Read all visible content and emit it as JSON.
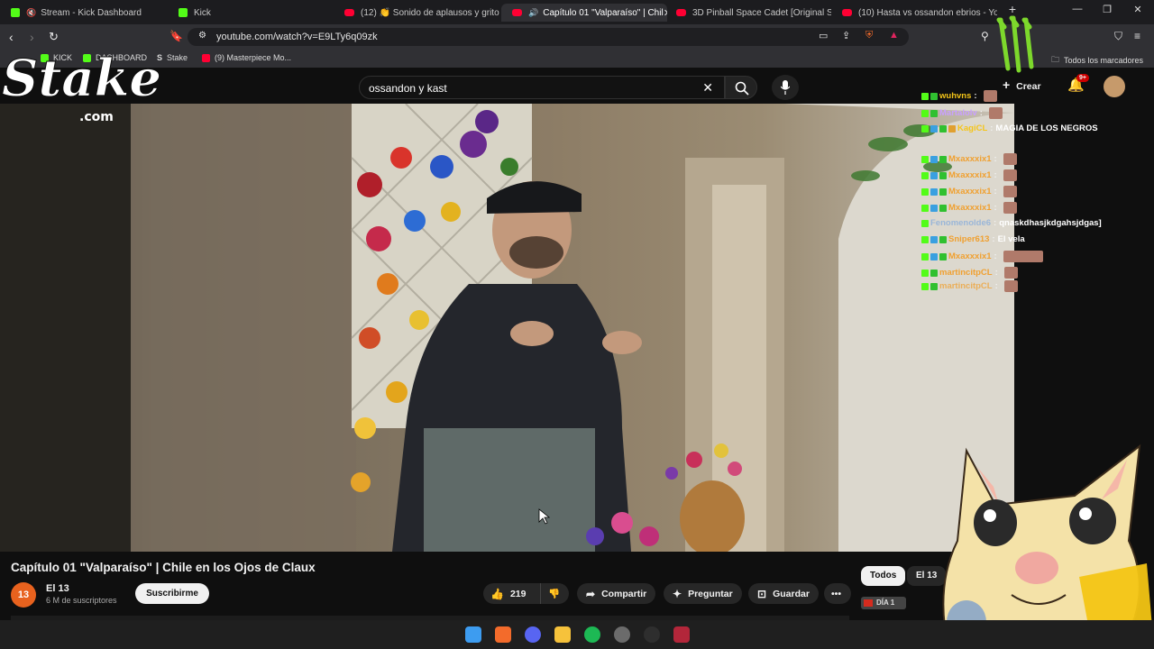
{
  "browser": {
    "tabs": [
      {
        "label": "Stream - Kick Dashboard",
        "favicon": "kick-icon"
      },
      {
        "label": "Kick",
        "favicon": "kick-icon"
      },
      {
        "label": "(12) 👏 Sonido de aplausos y gritos",
        "favicon": "youtube-icon"
      },
      {
        "label": "Capítulo 01 \"Valparaíso\" | Chil",
        "favicon": "youtube-icon",
        "active": true
      },
      {
        "label": "3D Pinball Space Cadet [Original Sou",
        "favicon": "youtube-icon"
      },
      {
        "label": "(10) Hasta vs ossandon ebrios - YouT",
        "favicon": "youtube-icon"
      }
    ],
    "url": "youtube.com/watch?v=E9LTy6q09zk",
    "bookmarks": [
      {
        "label": "KICK"
      },
      {
        "label": "DASHBOARD"
      },
      {
        "label": "Stake"
      },
      {
        "label": "(9) Masterpiece Mo..."
      }
    ],
    "all_bookmarks_label": "Todos los marcadores"
  },
  "youtube": {
    "search_value": "ossandon y kast",
    "create_label": "Crear",
    "notification_count": "9+",
    "video_title": "Capítulo 01 \"Valparaíso\" | Chile en los Ojos de Claux",
    "channel": {
      "avatar_text": "13",
      "name": "El 13",
      "subscribers": "6 M de suscriptores",
      "subscribe_label": "Suscribirme"
    },
    "actions": {
      "like_count": "219",
      "share_label": "Compartir",
      "ask_label": "Preguntar",
      "save_label": "Guardar"
    },
    "chips": [
      "Todos",
      "El 13"
    ]
  },
  "overlay": {
    "stake_logo_text": "Stake",
    "stake_logo_sub": ".com",
    "chat": [
      {
        "user": "wuhvns",
        "msg": "",
        "color": "#f5c518"
      },
      {
        "user": "Martalolv",
        "msg": "",
        "color": "#c9a0ff"
      },
      {
        "user": "KagiCL",
        "msg": "MAGIA DE LOS NEGROS",
        "color": "#f5c518"
      },
      {
        "user": "Mxaxxxix1",
        "msg": "",
        "color": "#f0a030"
      },
      {
        "user": "Mxaxxxix1",
        "msg": "",
        "color": "#f0a030"
      },
      {
        "user": "Mxaxxxix1",
        "msg": "",
        "color": "#f0a030"
      },
      {
        "user": "Mxaxxxix1",
        "msg": "",
        "color": "#f0a030"
      },
      {
        "user": "Fenomenolde6",
        "msg": "qnaskdhasjkdgahsjdgas]",
        "color": "#9ab6d8"
      },
      {
        "user": "Sniper613",
        "msg": "El vela",
        "color": "#f0a030"
      },
      {
        "user": "Mxaxxxix1",
        "msg": "",
        "color": "#f0a030"
      },
      {
        "user": "martincitpCL",
        "msg": "",
        "color": "#f0a030"
      },
      {
        "user": "martincitpCL",
        "msg": "",
        "color": "#f0a030"
      }
    ],
    "streamer_tag": "DÍA 1"
  },
  "colors": {
    "kick_green": "#53fc18",
    "youtube_red": "#ff0033",
    "accent": "#f1f1f1"
  }
}
